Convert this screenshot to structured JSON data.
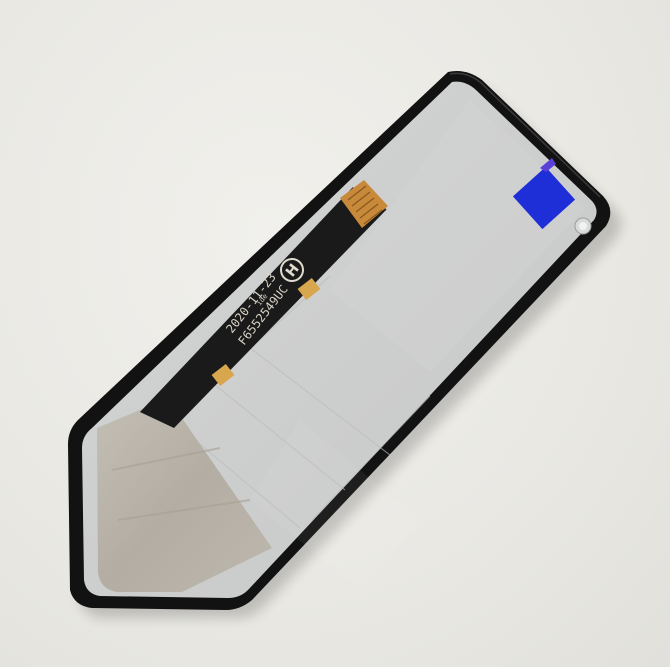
{
  "photo": {
    "subject": "lcd-display-assembly",
    "background_color": "#ecebe7",
    "panel_color": "#cfd0d0",
    "bezel_color": "#121212",
    "flex_cable_color": "#1a1a1a",
    "blue_sticker_color": "#1f2fd8",
    "foil_tape_color": "#b8b3a9",
    "contact_pad_color": "#d8a64c"
  },
  "flex_cable": {
    "part_number": "F6552549UC",
    "date_code": "2020-11-23",
    "small_mark": "ide",
    "logo_letter": "H"
  }
}
